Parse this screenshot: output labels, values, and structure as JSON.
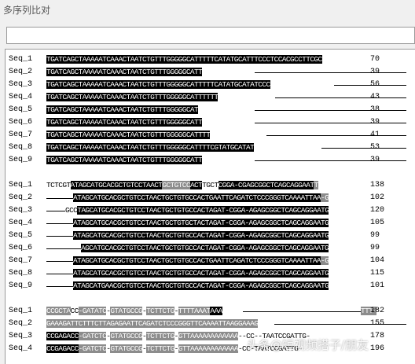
{
  "window": {
    "title": "多序列比对"
  },
  "blocks": [
    {
      "rows": [
        {
          "name": "Seq_1",
          "count": "70",
          "segs": [
            [
              "b",
              "TGATCAGCTAAAAATCAAACTAATCTGTTTGGGGGCATTTTTCATATGCATTTCCCTCCACGCCTTCGC"
            ]
          ],
          "line": null
        },
        {
          "name": "Seq_2",
          "count": "39",
          "segs": [
            [
              "b",
              "TGATCAGCTAAAAATCAAACTAATCTGTTTGGGGGCATT"
            ]
          ],
          "line": [
            265,
            458
          ]
        },
        {
          "name": "Seq_3",
          "count": "56",
          "segs": [
            [
              "b",
              "TGATCAGCTAAAAATCAAACTAATCTGTTTGGGGGCATTTTTCATATGCATATCCC"
            ]
          ],
          "line": [
            366,
            458
          ]
        },
        {
          "name": "Seq_4",
          "count": "43",
          "segs": [
            [
              "b",
              "TGATCAGCTAAAAATCAAACTAATCTGTTTGGGGGCATTTTTT"
            ]
          ],
          "line": [
            291,
            458
          ]
        },
        {
          "name": "Seq_5",
          "count": "38",
          "segs": [
            [
              "b",
              "TGATCAGCTAAAAATCAAACTAATCTGTTTGGGGGCAT"
            ]
          ],
          "line": [
            265,
            458
          ]
        },
        {
          "name": "Seq_6",
          "count": "39",
          "segs": [
            [
              "b",
              "TGATCAGCTAAAAATCAAACTAATCTGTTTGGGGGCATT"
            ]
          ],
          "line": [
            265,
            458
          ]
        },
        {
          "name": "Seq_7",
          "count": "41",
          "segs": [
            [
              "b",
              "TGATCAGCTAAAAATCAAACTAATCTGTTTGGGGGCATTTT"
            ]
          ],
          "line": [
            280,
            458
          ]
        },
        {
          "name": "Seq_8",
          "count": "53",
          "segs": [
            [
              "b",
              "TGATCAGCTAAAAATCAAACTAATCTGTTTGGGGGCATTTTCGTATGCATAT"
            ]
          ],
          "line": [
            350,
            458
          ]
        },
        {
          "name": "Seq_9",
          "count": "39",
          "segs": [
            [
              "b",
              "TGATCAGCTAAAAATCAAACTAATCTGTTTGGGGGCATT"
            ]
          ],
          "line": [
            265,
            458
          ]
        }
      ]
    },
    {
      "rows": [
        {
          "name": "Seq_1",
          "count": "138",
          "segs": [
            [
              "w",
              "TCTCGT"
            ],
            [
              "b",
              "ATAGCATGCACGCTGTCCTAACT"
            ],
            [
              "g",
              "GCTGTCC"
            ],
            [
              "b",
              "ACT"
            ],
            [
              "w",
              "TGCT"
            ],
            [
              "b",
              "CGGA-CGAGCGGCTCAGCAGGAAT"
            ],
            [
              "g",
              "T"
            ]
          ],
          "line": null
        },
        {
          "name": "Seq_2",
          "count": "102",
          "segs": [
            [
              "b",
              "ATAGCATGCACGCTGTCCTAACTGCTGTGCCACTGAATTCAGATCTCCCGGGTCAAAATTAA"
            ],
            [
              "g",
              "-G"
            ]
          ],
          "line": [
            0,
            34
          ]
        },
        {
          "name": "Seq_3",
          "count": "120",
          "segs": [
            [
              "w",
              "GCC"
            ],
            [
              "b",
              "TAGCATGCACGCTGTCCTAACTGCTGTGCCACTAGAT-CGGA-AGAGCGGCTCAGCAGGAATG"
            ]
          ],
          "line": [
            0,
            24
          ]
        },
        {
          "name": "Seq_4",
          "count": "105",
          "segs": [
            [
              "b",
              "ATAGCATGCACGCTGTCCTAACTGCTGTGCTACTAGAT-CGGA-AGAGCGGCTCAGCAGGAATG"
            ]
          ],
          "line": [
            0,
            34
          ]
        },
        {
          "name": "Seq_5",
          "count": "99",
          "segs": [
            [
              "b",
              "ATAGCATGCACGCTGTCCTAACTGCTGTGCCACTAGAT-CGGA-AGAGCGGCTCAGCAGGAATG"
            ]
          ],
          "line": [
            0,
            34
          ]
        },
        {
          "name": "Seq_6",
          "count": "99",
          "segs": [
            [
              "b",
              "AGCATGCACGCTGTCCTAACTGCTGTGCCACTAGAT-CGGA-AGAGCGGCTCAGCAGGAATG"
            ]
          ],
          "line": [
            0,
            44
          ]
        },
        {
          "name": "Seq_7",
          "count": "104",
          "segs": [
            [
              "b",
              "ATAGCATGCACGCTGTCCTAACTGCTGTGCCACTGAATTCAGATCTCCCGGGTCAAAATTAA"
            ],
            [
              "g",
              "-G"
            ]
          ],
          "line": [
            0,
            34
          ]
        },
        {
          "name": "Seq_8",
          "count": "115",
          "segs": [
            [
              "b",
              "ATAGCATGCACGCTGTCCTAACTGCTGTGCCACTAGAT-CGGA-AGAGCGGCTCAGCAGGAATG"
            ]
          ],
          "line": [
            0,
            34
          ]
        },
        {
          "name": "Seq_9",
          "count": "101",
          "segs": [
            [
              "b",
              "ATAGCATGAACGCTGTCCTAACTGCTGTGCCACTAGAT-CGGA-AGAGCGGCTCAGCAGGAATG"
            ]
          ],
          "line": [
            0,
            34
          ]
        }
      ]
    },
    {
      "rows": [
        {
          "name": "Seq_1",
          "count": "182",
          "segs": [
            [
              "g",
              "CCGCTA"
            ],
            [
              "w",
              "CC"
            ],
            [
              "g",
              "-GATATC"
            ],
            [
              "w",
              "-"
            ],
            [
              "g",
              "GTATGCCG"
            ],
            [
              "w",
              "-"
            ],
            [
              "g",
              "TCTTCTG"
            ],
            [
              "w",
              "-"
            ],
            [
              "g",
              "TTTTAAAT"
            ],
            [
              "b",
              "AAA"
            ]
          ],
          "line": [
            250,
            400
          ],
          "tail": "TTT-"
        },
        {
          "name": "Seq_2",
          "count": "155",
          "segs": [
            [
              "g",
              "GAAAGATTCTTTCTTAGAGAATTCAGATCTCCCGGGTTCAAAATTAAGGAAAG"
            ]
          ],
          "line": [
            290,
            458
          ]
        },
        {
          "name": "Seq_3",
          "count": "178",
          "segs": [
            [
              "b",
              "CCGAGACC"
            ],
            [
              "g",
              "-GATCTC"
            ],
            [
              "w",
              "-"
            ],
            [
              "g",
              "GTATGCCG"
            ],
            [
              "w",
              "-"
            ],
            [
              "g",
              "TCTTCTG"
            ],
            [
              "w",
              "-"
            ],
            [
              "g",
              "GTTAAAAAAAAAAAA"
            ],
            [
              "w",
              "--CC--TAATCCGATTG-"
            ]
          ],
          "line": null
        },
        {
          "name": "Seq_4",
          "count": "196",
          "segs": [
            [
              "b",
              "CCGAGACC"
            ],
            [
              "g",
              "-GATCTC"
            ],
            [
              "w",
              "-"
            ],
            [
              "g",
              "GTATGCCG"
            ],
            [
              "w",
              "-"
            ],
            [
              "g",
              "TCTTCTG"
            ],
            [
              "w",
              "-"
            ],
            [
              "g",
              "GTTAAAAAAAAAAAA"
            ],
            [
              "w",
              "-CC-TAATCCGATTG-"
            ]
          ],
          "line": null
        }
      ]
    }
  ],
  "watermark": "头条@短视频搭子/朋友"
}
